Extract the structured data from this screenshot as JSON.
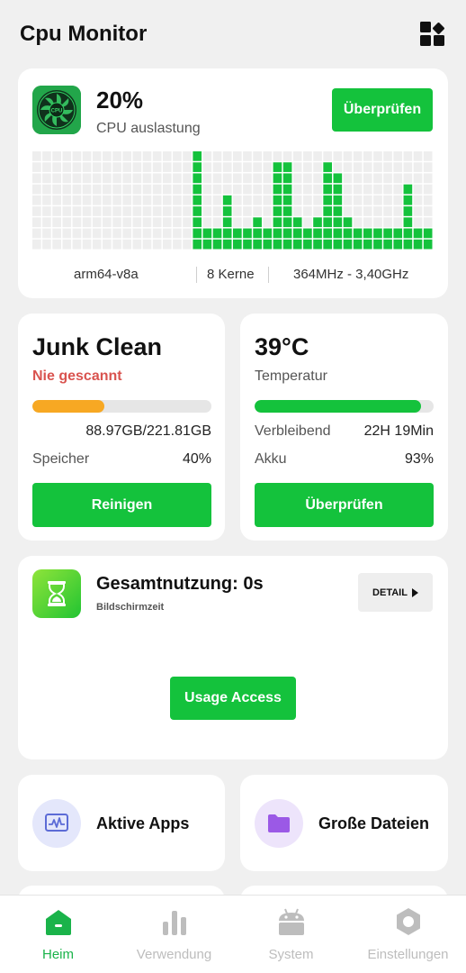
{
  "header": {
    "title": "Cpu Monitor",
    "menu_icon": "grid-apps-icon"
  },
  "cpu": {
    "logo_text": "CPU",
    "percent": "20%",
    "label": "CPU auslastung",
    "check_button": "Überprüfen",
    "graph_levels": [
      0,
      0,
      0,
      0,
      0,
      0,
      0,
      0,
      0,
      0,
      0,
      0,
      0,
      0,
      0,
      0,
      9,
      2,
      2,
      5,
      2,
      2,
      3,
      2,
      8,
      8,
      3,
      2,
      3,
      8,
      7,
      3,
      2,
      2,
      2,
      2,
      2,
      6,
      2,
      2
    ],
    "graph_max": 9,
    "architecture": "arm64-v8a",
    "cores": "8 Kerne",
    "frequency": "364MHz - 3,40GHz",
    "colors": {
      "active": "#14c23c",
      "inactive": "#eeeeee"
    }
  },
  "junk": {
    "title": "Junk Clean",
    "status": "Nie gescannt",
    "usage_fraction": 0.4,
    "size": "88.97GB/221.81GB",
    "storage_label": "Speicher",
    "storage_value": "40%",
    "clean_button": "Reinigen",
    "bar_color": "#f7a823"
  },
  "temperature": {
    "value": "39°C",
    "label": "Temperatur",
    "battery_fraction": 0.93,
    "remaining_label": "Verbleibend",
    "remaining_value": "22H 19Min",
    "battery_label": "Akku",
    "battery_value": "93%",
    "check_button": "Überprüfen",
    "bar_color": "#14c23c"
  },
  "usage": {
    "title": "Gesamtnutzung: 0s",
    "subtitle": "Bildschirmzeit",
    "detail_button": "DETAIL",
    "access_button": "Usage Access",
    "icon": "hourglass-icon"
  },
  "tools": [
    {
      "label": "Aktive Apps",
      "icon": "activity-monitor-icon",
      "bg": "#e4e7fb",
      "color": "#5c6bd6"
    },
    {
      "label": "Große Dateien",
      "icon": "folder-icon",
      "bg": "#ede4fb",
      "color": "#9b59e6"
    }
  ],
  "nav": [
    {
      "label": "Heim",
      "icon": "home-icon",
      "active": true
    },
    {
      "label": "Verwendung",
      "icon": "bar-chart-icon",
      "active": false
    },
    {
      "label": "System",
      "icon": "android-icon",
      "active": false
    },
    {
      "label": "Einstellungen",
      "icon": "settings-hexagon-icon",
      "active": false
    }
  ]
}
